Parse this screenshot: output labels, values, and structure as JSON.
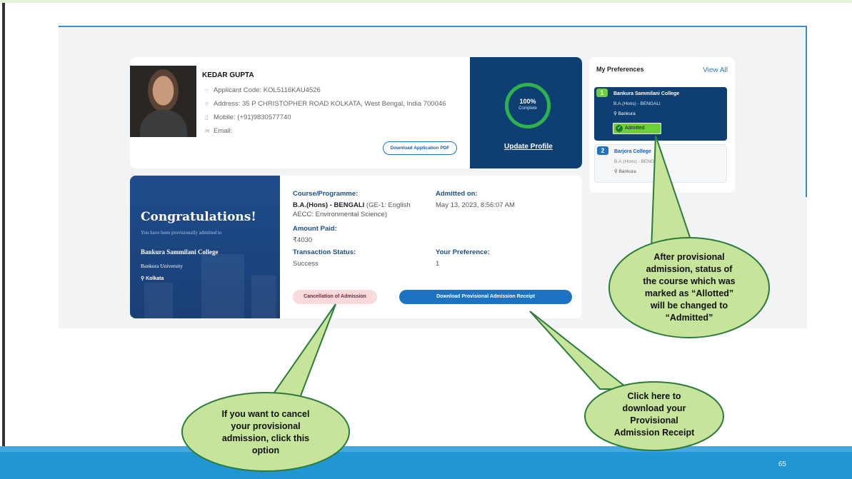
{
  "profile": {
    "name": "KEDAR GUPTA",
    "applicant_code": "Applicant Code: KOL5116KAU4526",
    "address": "Address: 35 P CHRISTOPHER ROAD KOLKATA, West Bengal, India 700046",
    "mobile": "Mobile: (+91)9830577740",
    "email": "Email:",
    "download_pdf": "Download Application PDF",
    "progress_value": "100%",
    "progress_label": "Complete",
    "progress_fraction": 1.0,
    "update_profile": "Update Profile"
  },
  "admission": {
    "congrats": "Congratulations!",
    "subtitle": "You have been provisionally admitted to",
    "college": "Bankura Sammilani College",
    "university": "Bankura University",
    "location": "Kolkata",
    "course_label": "Course/Programme:",
    "course_name": "B.A.(Hons) - BENGALI",
    "course_detail_1": " (GE-1: English",
    "course_detail_2": "AECC: Environmental Science)",
    "admitted_on_label": "Admitted on:",
    "admitted_on": "May 13, 2023, 8:56:07 AM",
    "amount_label": "Amount Paid:",
    "amount": "₹4030",
    "txn_label": "Transaction Status:",
    "txn_status": "Success",
    "pref_label": "Your Preference:",
    "pref_value": "1",
    "cancel_button": "Cancellation of Admission",
    "receipt_button": "Download Provisional Admission Receipt"
  },
  "preferences": {
    "title": "My Preferences",
    "view_all": "View All",
    "items": [
      {
        "num": "1",
        "college": "Bankura Sammilani College",
        "course": "B.A.(Hons) - BENGALI",
        "city": "Bankura",
        "status": "Admitted"
      },
      {
        "num": "2",
        "college": "Barjora College",
        "course": "B.A.(Hons) - BENGALI",
        "city": "Bankura"
      }
    ]
  },
  "callouts": {
    "status": [
      "After provisional",
      "admission, status of",
      "the course which was",
      "marked as “Allotted”",
      "will be changed to",
      "“Admitted”"
    ],
    "cancel": [
      "If you want to cancel",
      "your provisional",
      "admission, click this",
      "option"
    ],
    "receipt": [
      "Click here to",
      "download your",
      "Provisional",
      "Admission Receipt"
    ]
  },
  "page_number": "65",
  "colors": {
    "navy": "#0d3f73",
    "accent_blue": "#1d72c2",
    "callout_fill": "#c7e59a",
    "callout_stroke": "#2c7a3c",
    "green_badge": "#6fcf3a"
  }
}
